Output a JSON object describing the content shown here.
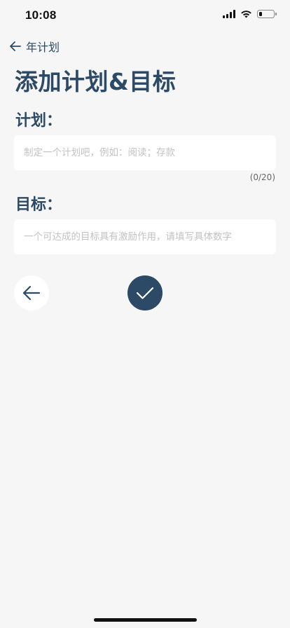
{
  "status_bar": {
    "time": "10:08",
    "battery_level": 0.22,
    "icons": [
      "cellular-signal-icon",
      "wifi-icon",
      "battery-icon"
    ]
  },
  "nav": {
    "back_label": "年计划",
    "back_icon": "arrow-left-icon"
  },
  "page": {
    "title": "添加计划&目标"
  },
  "plan": {
    "label": "计划：",
    "value": "",
    "placeholder": "制定一个计划吧，例如：阅读；存款",
    "char_count": "(0/20)"
  },
  "goal": {
    "label": "目标：",
    "value": "",
    "placeholder": "一个可达成的目标具有激励作用，请填写具体数字"
  },
  "actions": {
    "back_icon": "arrow-left-icon",
    "confirm_icon": "checkmark-icon"
  },
  "colors": {
    "primary": "#2c4a66",
    "background": "#f6f6f6",
    "surface": "#ffffff",
    "placeholder": "#c2c2c2"
  }
}
